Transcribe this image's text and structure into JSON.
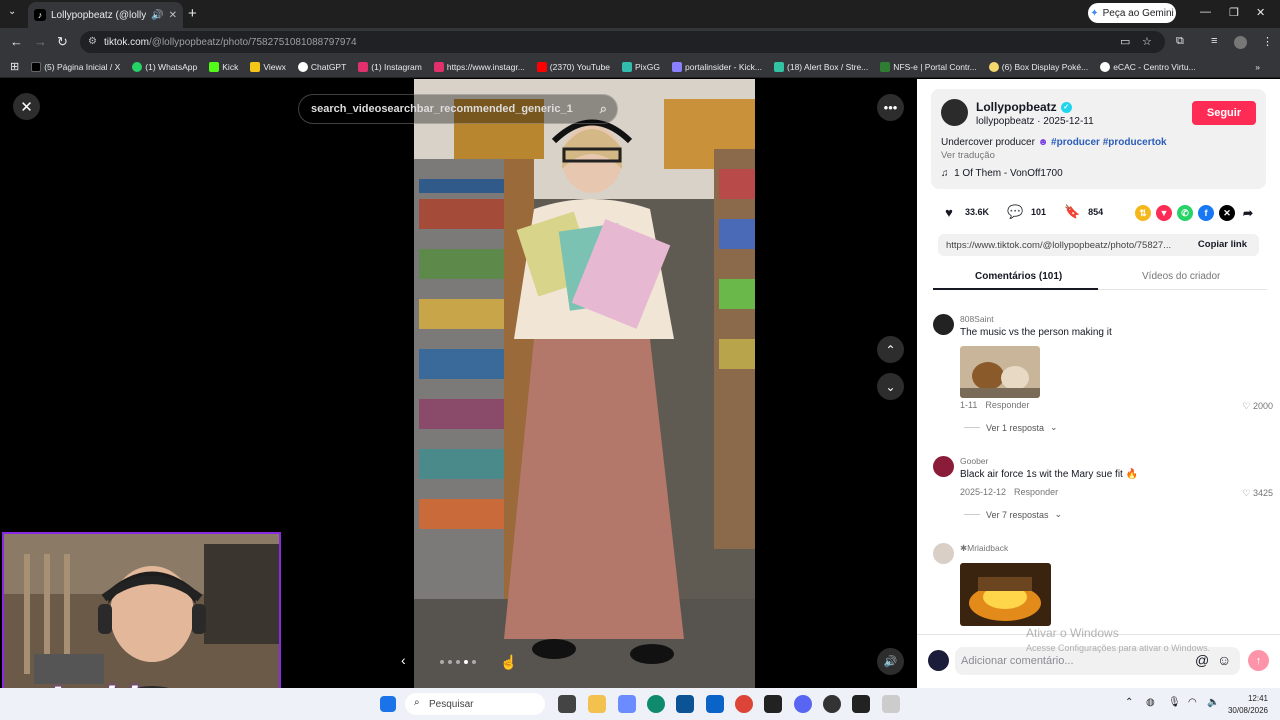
{
  "browser": {
    "tab_title": "Lollypopbeatz (@lollypopb",
    "gemini_label": "Peça ao Gemini",
    "url_host": "tiktok.com",
    "url_path": "/@lollypopbeatz/photo/7582751081088797974"
  },
  "bookmarks": [
    {
      "label": "(5) Página Inicial / X",
      "color": "#000000"
    },
    {
      "label": "(1) WhatsApp",
      "color": "#25d366"
    },
    {
      "label": "Kick",
      "color": "#53fc18"
    },
    {
      "label": "Viewx",
      "color": "#f5c518"
    },
    {
      "label": "ChatGPT",
      "color": "#ffffff"
    },
    {
      "label": "(1) Instagram",
      "color": "#e1306c"
    },
    {
      "label": "https://www.instagr...",
      "color": "#e1306c"
    },
    {
      "label": "(2370) YouTube",
      "color": "#ff0000"
    },
    {
      "label": "PixGG",
      "color": "#32bcad"
    },
    {
      "label": "portalinsider - Kick...",
      "color": "#8a7fff"
    },
    {
      "label": "(18) Alert Box / Stre...",
      "color": "#31c3a2"
    },
    {
      "label": "NFS-e | Portal Contr...",
      "color": "#2e7d32"
    },
    {
      "label": "(6) Box Display Poké...",
      "color": "#f5d76e"
    },
    {
      "label": "eCAC - Centro Virtu...",
      "color": "#ffffff"
    }
  ],
  "viewer": {
    "search_text": "search_videosearchbar_recommended_generic_1"
  },
  "author": {
    "name": "Lollypopbeatz",
    "handle": "lollypopbeatz",
    "date": "2025-12-11",
    "follow_label": "Seguir",
    "caption_text": "Undercover producer",
    "tags": [
      "#producer",
      "#producertok"
    ],
    "translate_label": "Ver tradução",
    "music": "1 Of Them - VonOff1700"
  },
  "stats": {
    "likes": "33.6K",
    "comments": "101",
    "saves": "854"
  },
  "share": {
    "link": "https://www.tiktok.com/@lollypopbeatz/photo/75827...",
    "copy_label": "Copiar link"
  },
  "tabs": {
    "comments": "Comentários (101)",
    "creator_videos": "Vídeos do criador"
  },
  "comments": [
    {
      "user": "808Saint",
      "text": "The music vs the person making it",
      "date": "1-11",
      "reply": "Responder",
      "likes": "2000",
      "replies": "Ver 1 resposta"
    },
    {
      "user": "Goober",
      "text": "Black air force 1s wit the Mary sue fit 🔥",
      "date": "2025-12-12",
      "reply": "Responder",
      "likes": "3425",
      "replies": "Ver 7 respostas"
    },
    {
      "user": "Mrlaidback",
      "text": "",
      "date": "",
      "reply": "",
      "likes": "",
      "replies": ""
    }
  ],
  "add_comment": {
    "placeholder": "Adicionar comentário...",
    "at_label": "@"
  },
  "watermark": {
    "line1": "Ativar o Windows",
    "line2": "Acesse Configurações para ativar o Windows."
  },
  "taskbar": {
    "search_label": "Pesquisar",
    "time": "12:41",
    "date": "30/08/2026"
  },
  "overlay": {
    "brand": "Insider"
  }
}
